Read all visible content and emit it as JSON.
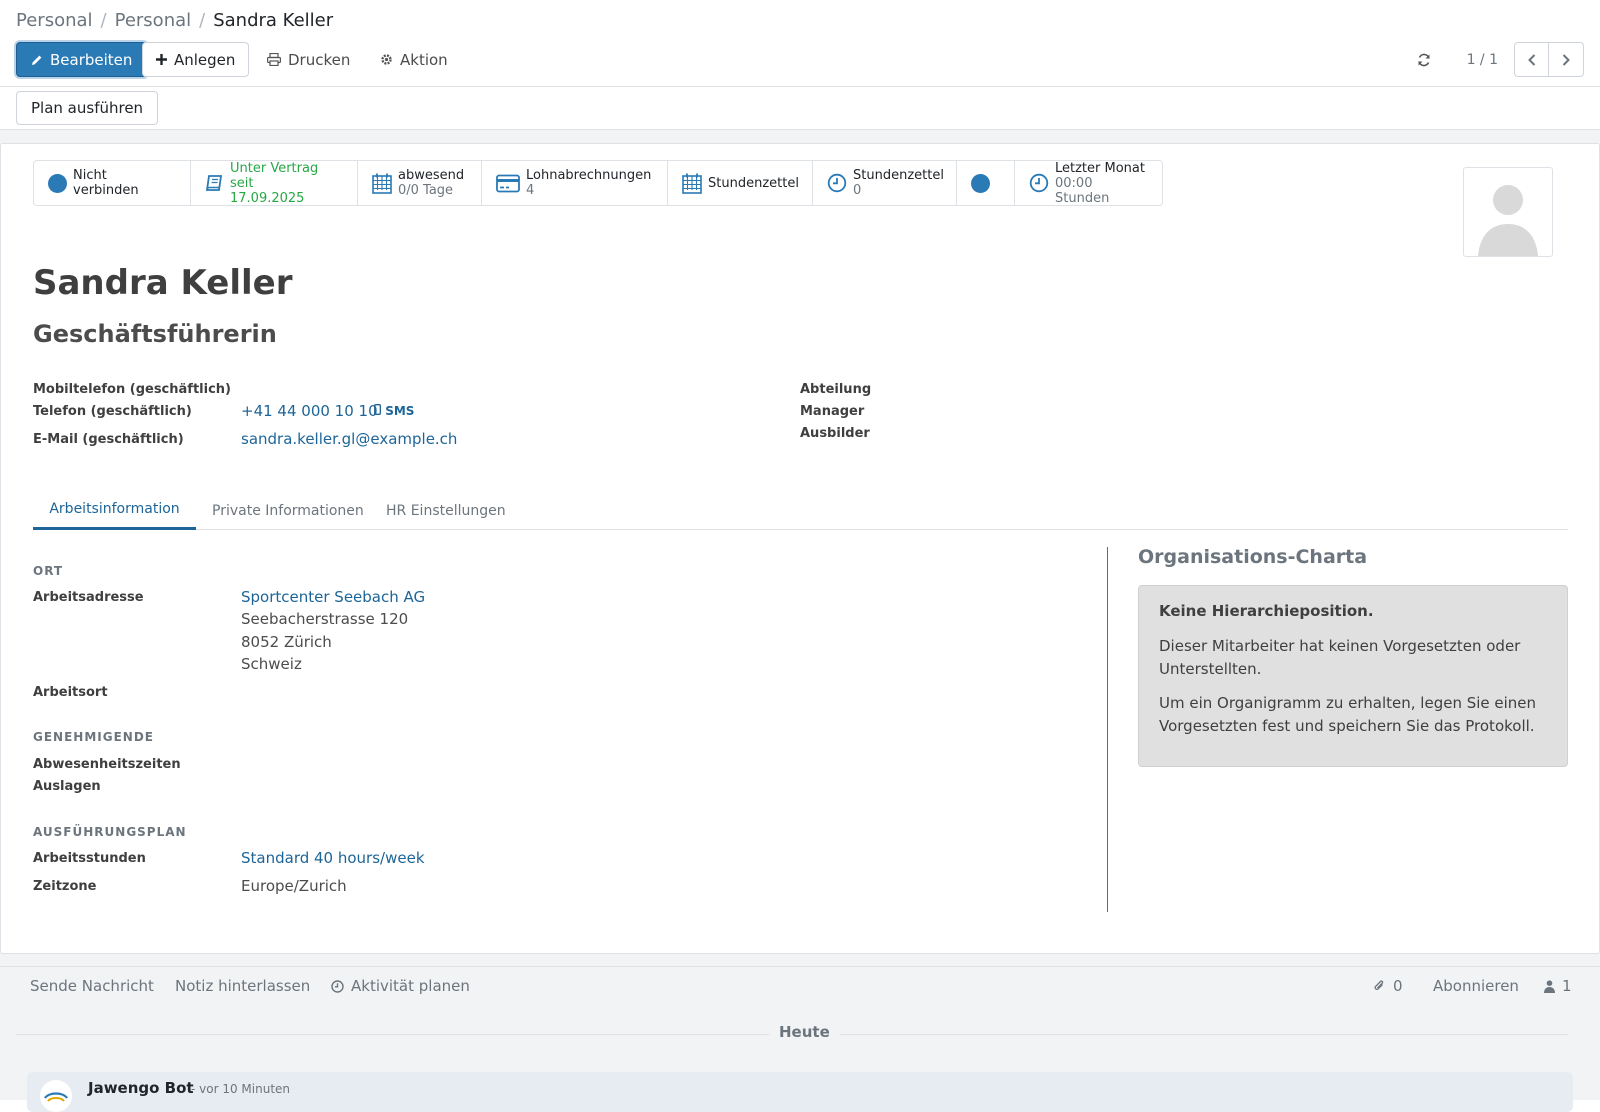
{
  "breadcrumb": {
    "items": [
      "Personal",
      "Personal"
    ],
    "current": "Sandra Keller"
  },
  "toolbar": {
    "edit_label": "Bearbeiten",
    "create_label": "Anlegen",
    "print_label": "Drucken",
    "action_label": "Aktion",
    "pager_text": "1 / 1",
    "plan_label": "Plan ausführen"
  },
  "buttonbox": {
    "connect": "Nicht verbinden",
    "contract_l1": "Unter Vertrag seit",
    "contract_l2": "17.09.2025",
    "absent_l1": "abwesend",
    "absent_l2": "0/0 Tage",
    "payslips_l1": "Lohnabrechnungen",
    "payslips_l2": "4",
    "timesheet": "Stundenzettel",
    "timesheet2_l1": "Stundenzettel",
    "timesheet2_l2": "0",
    "lastmonth_l1": "Letzter Monat",
    "lastmonth_l2": "00:00 Stunden"
  },
  "employee": {
    "name": "Sandra Keller",
    "job_title": "Geschäftsführerin"
  },
  "contact": {
    "mobile_label": "Mobiltelefon (geschäftlich)",
    "phone_label": "Telefon (geschäftlich)",
    "phone_value": "+41 44 000 10 10",
    "sms_label": "SMS",
    "email_label": "E-Mail (geschäftlich)",
    "email_value": "sandra.keller.gl@example.ch",
    "department_label": "Abteilung",
    "manager_label": "Manager",
    "coach_label": "Ausbilder"
  },
  "tabs": [
    "Arbeitsinformation",
    "Private Informationen",
    "HR Einstellungen"
  ],
  "work": {
    "location_section": "ORT",
    "address_label": "Arbeitsadresse",
    "address_company": "Sportcenter Seebach AG",
    "address_street": "Seebacherstrasse 120",
    "address_city": "8052 Zürich",
    "address_country": "Schweiz",
    "worklocation_label": "Arbeitsort",
    "approvers_section": "GENEHMIGENDE",
    "timeoff_label": "Abwesenheitszeiten",
    "expenses_label": "Auslagen",
    "schedule_section": "AUSFÜHRUNGSPLAN",
    "hours_label": "Arbeitsstunden",
    "hours_value": "Standard 40 hours/week",
    "tz_label": "Zeitzone",
    "tz_value": "Europe/Zurich"
  },
  "org": {
    "title": "Organisations-Charta",
    "heading": "Keine Hierarchieposition.",
    "p1": "Dieser Mitarbeiter hat keinen Vorgesetzten oder Unterstellten.",
    "p2": "Um ein Organigramm zu erhalten, legen Sie einen Vorgesetzten fest und speichern Sie das Protokoll."
  },
  "chatter": {
    "send_message": "Sende Nachricht",
    "log_note": "Notiz hinterlassen",
    "schedule_activity": "Aktivität planen",
    "attachments_count": "0",
    "follow": "Abonnieren",
    "followers_count": "1",
    "today": "Heute",
    "author": "Jawengo Bot",
    "time": "- vor 10 Minuten"
  },
  "colors": {
    "primary": "#2a7ab5",
    "link": "#1d6598",
    "success": "#28a745"
  }
}
